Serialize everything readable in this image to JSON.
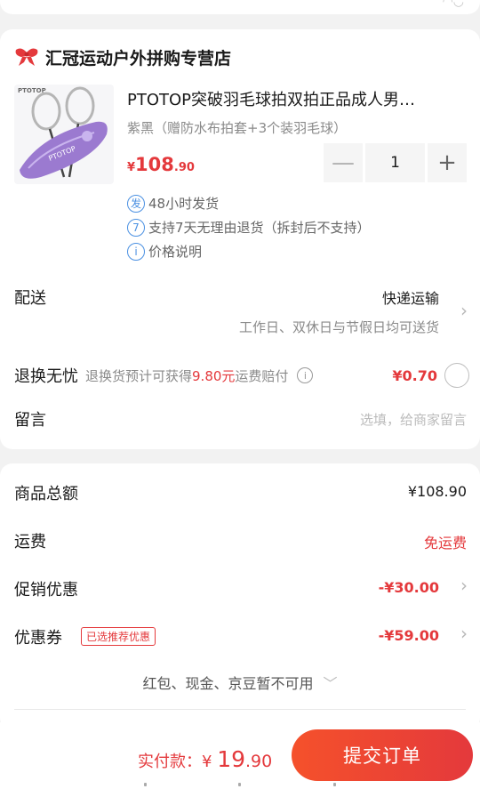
{
  "shop": {
    "name": "汇冠运动户外拼购专营店",
    "icon": "shop-bow-icon"
  },
  "product": {
    "title": "PTOTOP突破羽毛球拍双拍正品成人男…",
    "spec": "紫黑（赠防水布拍套+3个装羽毛球）",
    "price_currency": "¥",
    "price_int": "108",
    "price_dec": ".90",
    "quantity": "1",
    "minus_label": "—",
    "plus_label": "+",
    "thumb_brand": "PTOTOP"
  },
  "services": [
    {
      "icon": "发",
      "text": "48小时发货"
    },
    {
      "icon": "7",
      "text": "支持7天无理由退货（拆封后不支持）"
    },
    {
      "icon": "i",
      "text": "价格说明"
    }
  ],
  "delivery": {
    "label": "配送",
    "method": "快递运输",
    "detail": "工作日、双休日与节假日均可送货"
  },
  "refund": {
    "label": "退换无忧",
    "desc_prefix": "退换货预计可获得",
    "desc_amount": "9.80元",
    "desc_suffix": "运费赔付",
    "price": "¥0.70",
    "info_icon": "i"
  },
  "message": {
    "label": "留言",
    "placeholder": "选填，给商家留言"
  },
  "summary": {
    "total_label": "商品总额",
    "total_value": "¥108.90",
    "shipping_label": "运费",
    "shipping_value": "免运费",
    "promo_label": "促销优惠",
    "promo_value": "-¥30.00",
    "coupon_label": "优惠券",
    "coupon_badge": "已选推荐优惠",
    "coupon_value": "-¥59.00",
    "unavailable": "红包、现金、京豆暂不可用"
  },
  "footer": {
    "pay_label": "实付款：",
    "pay_currency": "¥ ",
    "pay_int": "19",
    "pay_dec": ".90",
    "submit_label": "提交订单"
  },
  "colors": {
    "accent": "#e4393c",
    "info": "#4a90e2"
  }
}
